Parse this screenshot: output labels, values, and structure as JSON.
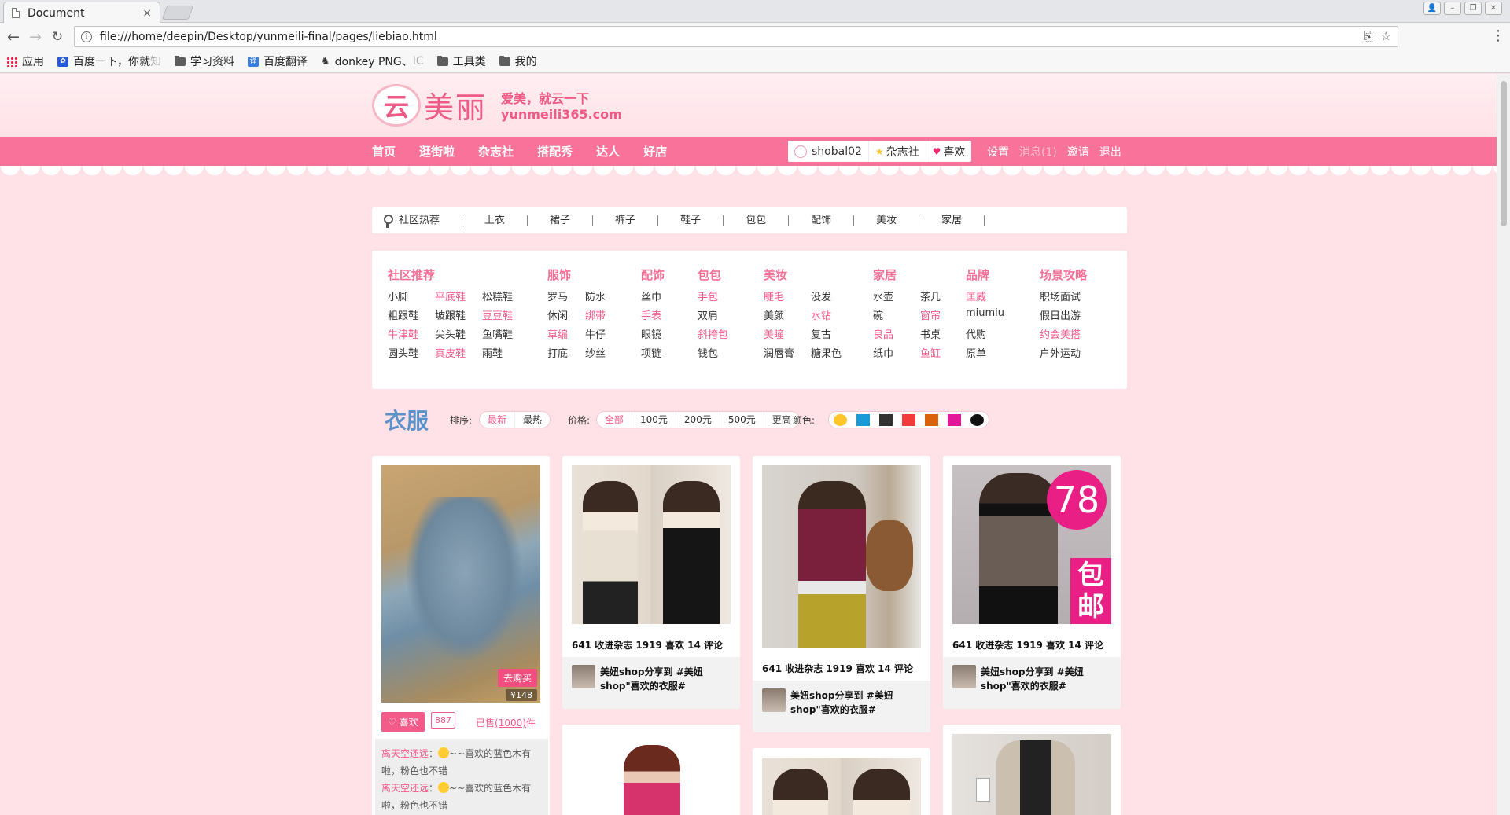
{
  "browser": {
    "tab_title": "Document",
    "tab_close": "×",
    "url": "file:///home/deepin/Desktop/yunmeili-final/pages/liebiao.html",
    "window_buttons": [
      "👤",
      "–",
      "❐",
      "✕"
    ],
    "bookmarks": [
      {
        "label": "应用",
        "icon": "apps-icon"
      },
      {
        "label": "百度一下，你就",
        "icon": "paw-icon",
        "faded": "知"
      },
      {
        "label": "学习资料",
        "icon": "folder-icon"
      },
      {
        "label": "百度翻译",
        "icon": "translate-icon"
      },
      {
        "label": "donkey PNG、",
        "icon": "donkey-icon",
        "faded": "IC"
      },
      {
        "label": "工具类",
        "icon": "folder-icon"
      },
      {
        "label": "我的",
        "icon": "folder-icon"
      }
    ]
  },
  "header": {
    "logo_char": "云",
    "logo_name": "美丽",
    "slogan": "爱美，就云一下",
    "domain": "yunmeili365.com"
  },
  "mainnav": {
    "items": [
      "首页",
      "逛街啦",
      "杂志社",
      "搭配秀",
      "达人",
      "好店"
    ],
    "username": "shobal02",
    "magazine": "杂志社",
    "like": "喜欢",
    "links": [
      "设置",
      "消息(1)",
      "邀请",
      "退出"
    ]
  },
  "categories": [
    "社区热荐",
    "上衣",
    "裙子",
    "裤子",
    "鞋子",
    "包包",
    "配饰",
    "美妆",
    "家居"
  ],
  "megamenu": [
    {
      "title": "社区推荐",
      "rows": [
        [
          {
            "t": "小脚"
          },
          {
            "t": "平底鞋",
            "hot": true
          },
          {
            "t": "松糕鞋"
          }
        ],
        [
          {
            "t": "粗跟鞋"
          },
          {
            "t": "坡跟鞋"
          },
          {
            "t": "豆豆鞋",
            "hot": true
          }
        ],
        [
          {
            "t": "牛津鞋",
            "hot": true
          },
          {
            "t": "尖头鞋"
          },
          {
            "t": "鱼嘴鞋"
          }
        ],
        [
          {
            "t": "圆头鞋"
          },
          {
            "t": "真皮鞋",
            "hot": true
          },
          {
            "t": "雨鞋"
          }
        ]
      ]
    },
    {
      "title": "服饰",
      "rows": [
        [
          {
            "t": "罗马"
          },
          {
            "t": "防水"
          }
        ],
        [
          {
            "t": "休闲"
          },
          {
            "t": "绑带",
            "hot": true
          }
        ],
        [
          {
            "t": "草编",
            "hot": true
          },
          {
            "t": "牛仔"
          }
        ],
        [
          {
            "t": "打底"
          },
          {
            "t": "纱丝"
          }
        ]
      ]
    },
    {
      "title": "配饰",
      "rows": [
        [
          {
            "t": "丝巾"
          }
        ],
        [
          {
            "t": "手表",
            "hot": true
          }
        ],
        [
          {
            "t": "眼镜"
          }
        ],
        [
          {
            "t": "项链"
          }
        ]
      ]
    },
    {
      "title": "包包",
      "rows": [
        [
          {
            "t": "手包",
            "hot": true
          }
        ],
        [
          {
            "t": "双肩"
          }
        ],
        [
          {
            "t": "斜挎包",
            "hot": true
          }
        ],
        [
          {
            "t": "钱包"
          }
        ]
      ]
    },
    {
      "title": "美妆",
      "rows": [
        [
          {
            "t": "睫毛",
            "hot": true
          },
          {
            "t": "没发"
          }
        ],
        [
          {
            "t": "美颜"
          },
          {
            "t": "水钻",
            "hot": true
          }
        ],
        [
          {
            "t": "美瞳",
            "hot": true
          },
          {
            "t": "复古"
          }
        ],
        [
          {
            "t": "润唇膏"
          },
          {
            "t": "糖果色"
          }
        ]
      ]
    },
    {
      "title": "家居",
      "rows": [
        [
          {
            "t": "水壶"
          },
          {
            "t": "茶几"
          }
        ],
        [
          {
            "t": "碗"
          },
          {
            "t": "窗帘",
            "hot": true
          }
        ],
        [
          {
            "t": "良品",
            "hot": true
          },
          {
            "t": "书桌"
          }
        ],
        [
          {
            "t": "纸巾"
          },
          {
            "t": "鱼缸",
            "hot": true
          }
        ]
      ]
    },
    {
      "title": "品牌",
      "rows": [
        [
          {
            "t": "匡威",
            "hot": true
          }
        ],
        [
          {
            "t": "miumiu"
          }
        ],
        [
          {
            "t": "代购"
          }
        ],
        [
          {
            "t": "原单"
          }
        ]
      ]
    },
    {
      "title": "场景攻略",
      "rows": [
        [
          {
            "t": "职场面试"
          }
        ],
        [
          {
            "t": "假日出游"
          }
        ],
        [
          {
            "t": "约会美搭",
            "hot": true
          }
        ],
        [
          {
            "t": "户外运动"
          }
        ]
      ]
    }
  ],
  "filter": {
    "title": "衣服",
    "sort_label": "排序:",
    "sort_options": [
      "最新",
      "最热"
    ],
    "price_label": "价格:",
    "price_options": [
      "全部",
      "100元",
      "200元",
      "500元",
      "更高"
    ],
    "color_label": "颜色:",
    "colors": [
      "#ffc62a",
      "#1a9ad6",
      "#333333",
      "#f23b3b",
      "#d9620a",
      "#e2189a",
      "#111111"
    ]
  },
  "cards": {
    "first": {
      "buy": "去购买",
      "price": "¥148",
      "like": "喜欢",
      "like_count": "887",
      "sold_prefix": "已售",
      "sold_count": "(1000)",
      "sold_suffix": "件",
      "comments": [
        {
          "name": "离天空还远",
          "text": "~~喜欢的蓝色木有啦，粉色也不错"
        },
        {
          "name": "离天空还远",
          "text": "~~喜欢的蓝色木有啦，粉色也不错"
        }
      ]
    },
    "stats": "641 收进杂志 1919 喜欢 14 评论",
    "share": "美妞shop分享到 #美妞shop\"喜欢的衣服#",
    "badge_number": "78",
    "badge_text": "包邮"
  }
}
